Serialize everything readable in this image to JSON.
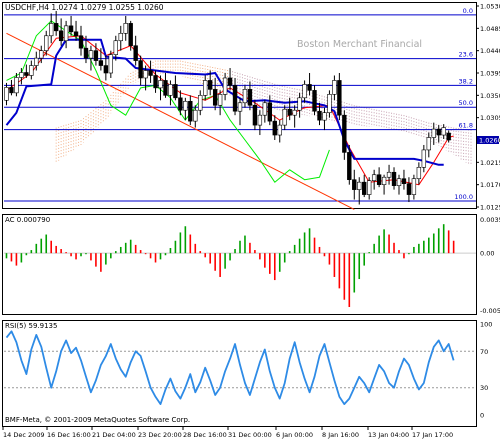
{
  "window": {
    "symbol_line": "USDCHF,H4  1.0274 1.0279 1.0255 1.0260",
    "watermark": "Boston Merchant Financial",
    "copyright": "BMF-Meta, © 2001-2009 MetaQuotes Software Corp."
  },
  "colors": {
    "background": "#ffffff",
    "frame": "#000000",
    "candle": "#000000",
    "level_lines": "#0000cc",
    "tenkan": "#ff0000",
    "kijun": "#0000cc",
    "chikou": "#00ee00",
    "trendline": "#ff3300",
    "cloud_bull": "#f2b28a",
    "cloud_bear": "#c7a3b3",
    "ac_up": "#00a000",
    "ac_down": "#ff0000",
    "rsi": "#2e8be6",
    "rsi_levels": "#999999",
    "price_badge": "#0000aa"
  },
  "chart_data": [
    {
      "type": "candlestick",
      "title": "USDCHF,H4",
      "ohlc_caption": "1.0274 1.0279 1.0255 1.0260",
      "ylim": [
        1.0125,
        1.053
      ],
      "y_ticks": [
        "1.0530",
        "1.0485",
        "1.0440",
        "1.0395",
        "1.0350",
        "1.0305",
        "1.0260",
        "1.0215",
        "1.0170",
        "1.0125"
      ],
      "current_price": "1.0260",
      "x_tick_labels": [
        "14 Dec 2009",
        "16 Dec 16:00",
        "21 Dec 04:00",
        "23 Dec 20:00",
        "28 Dec 16:00",
        "31 Dec 00:00",
        "6 Jan 00:00",
        "8 Jan 16:00",
        "13 Jan 04:00",
        "17 Jan 17:00"
      ],
      "fib_levels": [
        {
          "label": "0.0",
          "price": 1.0512
        },
        {
          "label": "23.6",
          "price": 1.0424
        },
        {
          "label": "38.2",
          "price": 1.037
        },
        {
          "label": "50.0",
          "price": 1.0326
        },
        {
          "label": "61.8",
          "price": 1.0281
        },
        {
          "label": "100.0",
          "price": 1.0137
        }
      ],
      "candles": [
        [
          1.034,
          1.0375,
          1.033,
          1.0366
        ],
        [
          1.0366,
          1.0381,
          1.035,
          1.0355
        ],
        [
          1.0355,
          1.0395,
          1.0348,
          1.0386
        ],
        [
          1.0386,
          1.0405,
          1.0372,
          1.0396
        ],
        [
          1.0396,
          1.0412,
          1.0385,
          1.039
        ],
        [
          1.039,
          1.042,
          1.0382,
          1.041
        ],
        [
          1.041,
          1.0438,
          1.04,
          1.0425
        ],
        [
          1.0425,
          1.045,
          1.0415,
          1.044
        ],
        [
          1.044,
          1.048,
          1.043,
          1.047
        ],
        [
          1.047,
          1.0515,
          1.0455,
          1.0495
        ],
        [
          1.0495,
          1.052,
          1.047,
          1.048
        ],
        [
          1.048,
          1.0505,
          1.045,
          1.046
        ],
        [
          1.046,
          1.05,
          1.0445,
          1.049
        ],
        [
          1.049,
          1.051,
          1.047,
          1.0478
        ],
        [
          1.0478,
          1.05,
          1.046,
          1.047
        ],
        [
          1.047,
          1.049,
          1.043,
          1.0445
        ],
        [
          1.0445,
          1.047,
          1.0415,
          1.0425
        ],
        [
          1.0425,
          1.045,
          1.04,
          1.044
        ],
        [
          1.044,
          1.0455,
          1.041,
          1.042
        ],
        [
          1.042,
          1.0445,
          1.04,
          1.041
        ],
        [
          1.041,
          1.043,
          1.038,
          1.0395
        ],
        [
          1.0395,
          1.044,
          1.0385,
          1.0432
        ],
        [
          1.0432,
          1.047,
          1.042,
          1.046
        ],
        [
          1.046,
          1.049,
          1.044,
          1.0475
        ],
        [
          1.0475,
          1.051,
          1.046,
          1.0495
        ],
        [
          1.0495,
          1.05,
          1.044,
          1.045
        ],
        [
          1.045,
          1.047,
          1.041,
          1.042
        ],
        [
          1.042,
          1.043,
          1.037,
          1.0385
        ],
        [
          1.0385,
          1.041,
          1.036,
          1.04
        ],
        [
          1.04,
          1.042,
          1.0375,
          1.039
        ],
        [
          1.039,
          1.04,
          1.0355,
          1.0365
        ],
        [
          1.0365,
          1.039,
          1.034,
          1.038
        ],
        [
          1.038,
          1.0395,
          1.0345,
          1.035
        ],
        [
          1.035,
          1.038,
          1.033,
          1.0372
        ],
        [
          1.0372,
          1.039,
          1.034,
          1.0345
        ],
        [
          1.0345,
          1.036,
          1.031,
          1.032
        ],
        [
          1.032,
          1.0345,
          1.03,
          1.0338
        ],
        [
          1.0338,
          1.035,
          1.029,
          1.0298
        ],
        [
          1.0298,
          1.033,
          1.0285,
          1.032
        ],
        [
          1.032,
          1.036,
          1.031,
          1.035
        ],
        [
          1.035,
          1.039,
          1.034,
          1.038
        ],
        [
          1.038,
          1.04,
          1.035,
          1.0362
        ],
        [
          1.0362,
          1.0385,
          1.032,
          1.033
        ],
        [
          1.033,
          1.036,
          1.031,
          1.0352
        ],
        [
          1.0352,
          1.0395,
          1.034,
          1.0385
        ],
        [
          1.0385,
          1.0405,
          1.036,
          1.037
        ],
        [
          1.037,
          1.0385,
          1.031,
          1.0318
        ],
        [
          1.0318,
          1.0345,
          1.029,
          1.0335
        ],
        [
          1.0335,
          1.037,
          1.0325,
          1.0362
        ],
        [
          1.0362,
          1.0378,
          1.032,
          1.033
        ],
        [
          1.033,
          1.034,
          1.028,
          1.029
        ],
        [
          1.029,
          1.032,
          1.027,
          1.031
        ],
        [
          1.031,
          1.034,
          1.0295,
          1.0335
        ],
        [
          1.0335,
          1.035,
          1.029,
          1.0298
        ],
        [
          1.0298,
          1.031,
          1.026,
          1.027
        ],
        [
          1.027,
          1.03,
          1.0255,
          1.029
        ],
        [
          1.029,
          1.033,
          1.028,
          1.0322
        ],
        [
          1.0322,
          1.0345,
          1.03,
          1.031
        ],
        [
          1.031,
          1.033,
          1.0285,
          1.032
        ],
        [
          1.032,
          1.0355,
          1.0305,
          1.0345
        ],
        [
          1.0345,
          1.038,
          1.0335,
          1.0372
        ],
        [
          1.0372,
          1.0395,
          1.035,
          1.036
        ],
        [
          1.036,
          1.037,
          1.031,
          1.0318
        ],
        [
          1.0318,
          1.0335,
          1.029,
          1.03
        ],
        [
          1.03,
          1.0325,
          1.028,
          1.0315
        ],
        [
          1.0315,
          1.036,
          1.0305,
          1.0352
        ],
        [
          1.0352,
          1.039,
          1.034,
          1.038
        ],
        [
          1.038,
          1.0395,
          1.03,
          1.031
        ],
        [
          1.031,
          1.032,
          1.022,
          1.0235
        ],
        [
          1.0235,
          1.025,
          1.017,
          1.018
        ],
        [
          1.018,
          1.02,
          1.014,
          1.016
        ],
        [
          1.016,
          1.0185,
          1.013,
          1.0175
        ],
        [
          1.0175,
          1.019,
          1.0145,
          1.015
        ],
        [
          1.015,
          1.0185,
          1.014,
          1.0178
        ],
        [
          1.0178,
          1.02,
          1.016,
          1.019
        ],
        [
          1.019,
          1.0205,
          1.0165,
          1.017
        ],
        [
          1.017,
          1.019,
          1.015,
          1.0185
        ],
        [
          1.0185,
          1.021,
          1.017,
          1.0195
        ],
        [
          1.0195,
          1.0205,
          1.016,
          1.0168
        ],
        [
          1.0168,
          1.019,
          1.015,
          1.0182
        ],
        [
          1.0182,
          1.02,
          1.016,
          1.0172
        ],
        [
          1.0172,
          1.0185,
          1.0135,
          1.015
        ],
        [
          1.015,
          1.019,
          1.014,
          1.0182
        ],
        [
          1.0182,
          1.0215,
          1.017,
          1.0205
        ],
        [
          1.0205,
          1.025,
          1.0195,
          1.024
        ],
        [
          1.024,
          1.0275,
          1.0225,
          1.0265
        ],
        [
          1.0265,
          1.0295,
          1.025,
          1.0282
        ],
        [
          1.0282,
          1.029,
          1.0255,
          1.027
        ],
        [
          1.027,
          1.0292,
          1.0262,
          1.0285
        ],
        [
          1.0274,
          1.0279,
          1.0255,
          1.026
        ]
      ],
      "tenkan": [
        [
          0,
          1.036
        ],
        [
          5,
          1.0395
        ],
        [
          10,
          1.0465
        ],
        [
          15,
          1.047
        ],
        [
          20,
          1.043
        ],
        [
          25,
          1.045
        ],
        [
          30,
          1.0392
        ],
        [
          35,
          1.0355
        ],
        [
          40,
          1.034
        ],
        [
          45,
          1.0365
        ],
        [
          50,
          1.0335
        ],
        [
          55,
          1.03
        ],
        [
          60,
          1.0325
        ],
        [
          65,
          1.033
        ],
        [
          69,
          1.0245
        ],
        [
          73,
          1.0175
        ],
        [
          78,
          1.018
        ],
        [
          83,
          1.017
        ],
        [
          86,
          1.0215
        ],
        [
          89,
          1.0265
        ],
        [
          90,
          1.0268
        ]
      ],
      "kijun": [
        [
          0,
          1.029
        ],
        [
          2,
          1.0315
        ],
        [
          4,
          1.0368
        ],
        [
          9,
          1.0372
        ],
        [
          10,
          1.043
        ],
        [
          12,
          1.0462
        ],
        [
          19,
          1.0462
        ],
        [
          20,
          1.0428
        ],
        [
          24,
          1.0424
        ],
        [
          26,
          1.0405
        ],
        [
          30,
          1.04
        ],
        [
          34,
          1.0395
        ],
        [
          40,
          1.0392
        ],
        [
          42,
          1.0395
        ],
        [
          44,
          1.0362
        ],
        [
          48,
          1.0338
        ],
        [
          52,
          1.034
        ],
        [
          56,
          1.0335
        ],
        [
          60,
          1.0338
        ],
        [
          64,
          1.033
        ],
        [
          66,
          1.0318
        ],
        [
          68,
          1.026
        ],
        [
          70,
          1.0222
        ],
        [
          82,
          1.0222
        ],
        [
          84,
          1.0218
        ],
        [
          87,
          1.021
        ],
        [
          88,
          1.021
        ]
      ],
      "chikou": [
        [
          0,
          1.038
        ],
        [
          3,
          1.0395
        ],
        [
          6,
          1.047
        ],
        [
          9,
          1.05
        ],
        [
          12,
          1.048
        ],
        [
          15,
          1.046
        ],
        [
          18,
          1.04
        ],
        [
          21,
          1.033
        ],
        [
          24,
          1.031
        ],
        [
          27,
          1.0365
        ],
        [
          30,
          1.037
        ],
        [
          33,
          1.0345
        ],
        [
          36,
          1.03
        ],
        [
          39,
          1.034
        ],
        [
          42,
          1.035
        ],
        [
          45,
          1.03
        ],
        [
          48,
          1.026
        ],
        [
          51,
          1.022
        ],
        [
          54,
          1.0175
        ],
        [
          57,
          1.02
        ],
        [
          60,
          1.018
        ],
        [
          63,
          1.0185
        ],
        [
          65,
          1.024
        ]
      ],
      "trendline": [
        [
          0,
          1.0475
        ],
        [
          70,
          1.012
        ]
      ],
      "cloud": [
        [
          10,
          1.0285,
          1.0215
        ],
        [
          15,
          1.03,
          1.025
        ],
        [
          20,
          1.034,
          1.03
        ],
        [
          25,
          1.0395,
          1.037
        ],
        [
          30,
          1.042,
          1.0395
        ],
        [
          35,
          1.042,
          1.039
        ],
        [
          40,
          1.041,
          1.037
        ],
        [
          45,
          1.04,
          1.035
        ],
        [
          50,
          1.0385,
          1.032
        ],
        [
          55,
          1.037,
          1.032
        ],
        [
          60,
          1.036,
          1.031
        ],
        [
          65,
          1.0345,
          1.03
        ],
        [
          70,
          1.033,
          1.029
        ],
        [
          75,
          1.032,
          1.0285
        ],
        [
          80,
          1.031,
          1.0275
        ],
        [
          85,
          1.0295,
          1.026
        ],
        [
          90,
          1.0285,
          1.023
        ],
        [
          94,
          1.028,
          1.0205
        ]
      ]
    },
    {
      "type": "bar",
      "title": "AC 0.000790",
      "y_ticks": [
        "0.00359",
        "0.00",
        "-0.00578"
      ],
      "ylim": [
        -0.00578,
        0.00359
      ],
      "values": [
        -0.0005,
        -0.0008,
        -0.0012,
        -0.0009,
        -0.0002,
        0.0003,
        0.0009,
        0.0014,
        0.0018,
        0.0012,
        0.0007,
        0.0004,
        0.0001,
        -0.0003,
        -0.0006,
        -0.0003,
        -0.0001,
        -0.0007,
        -0.0013,
        -0.0018,
        -0.0011,
        -0.0005,
        0.0002,
        0.0006,
        0.001,
        0.0013,
        0.0008,
        0.0003,
        -0.0001,
        -0.0005,
        -0.0009,
        -0.0006,
        -0.0002,
        0.0005,
        0.0012,
        0.002,
        0.0026,
        0.0018,
        0.0009,
        0.0002,
        -0.0004,
        -0.001,
        -0.0017,
        -0.0023,
        -0.0015,
        -0.0007,
        0.0004,
        0.0012,
        0.0017,
        0.001,
        0.0003,
        -0.0006,
        -0.0014,
        -0.002,
        -0.0026,
        -0.0018,
        -0.0009,
        0.0002,
        0.0008,
        0.0014,
        0.002,
        0.0024,
        0.0015,
        0.0006,
        -0.0003,
        -0.0011,
        -0.0023,
        -0.0034,
        -0.0045,
        -0.0052,
        -0.0038,
        -0.0025,
        -0.0012,
        0.0001,
        0.0009,
        0.0017,
        0.0023,
        0.0018,
        0.001,
        0.0003,
        -0.0005,
        -0.0001,
        0.0006,
        0.0009,
        0.0012,
        0.0015,
        0.0019,
        0.0024,
        0.0028,
        0.0022,
        0.0012
      ]
    },
    {
      "type": "line",
      "title": "RSI(5) 59.9135",
      "y_ticks": [
        "100",
        "70",
        "30",
        "0"
      ],
      "ylim": [
        0,
        100
      ],
      "levels": [
        70,
        30
      ],
      "values": [
        85,
        92,
        80,
        60,
        45,
        72,
        88,
        75,
        52,
        30,
        48,
        70,
        82,
        68,
        74,
        60,
        42,
        25,
        38,
        55,
        65,
        78,
        62,
        50,
        42,
        58,
        70,
        65,
        48,
        30,
        20,
        12,
        28,
        40,
        26,
        18,
        30,
        45,
        25,
        36,
        52,
        38,
        22,
        30,
        48,
        62,
        78,
        55,
        35,
        22,
        40,
        58,
        72,
        48,
        30,
        18,
        35,
        62,
        80,
        58,
        40,
        25,
        42,
        65,
        78,
        58,
        38,
        20,
        12,
        18,
        30,
        42,
        35,
        25,
        40,
        55,
        48,
        35,
        30,
        48,
        62,
        55,
        40,
        28,
        35,
        58,
        75,
        82,
        70,
        78,
        60
      ]
    }
  ]
}
